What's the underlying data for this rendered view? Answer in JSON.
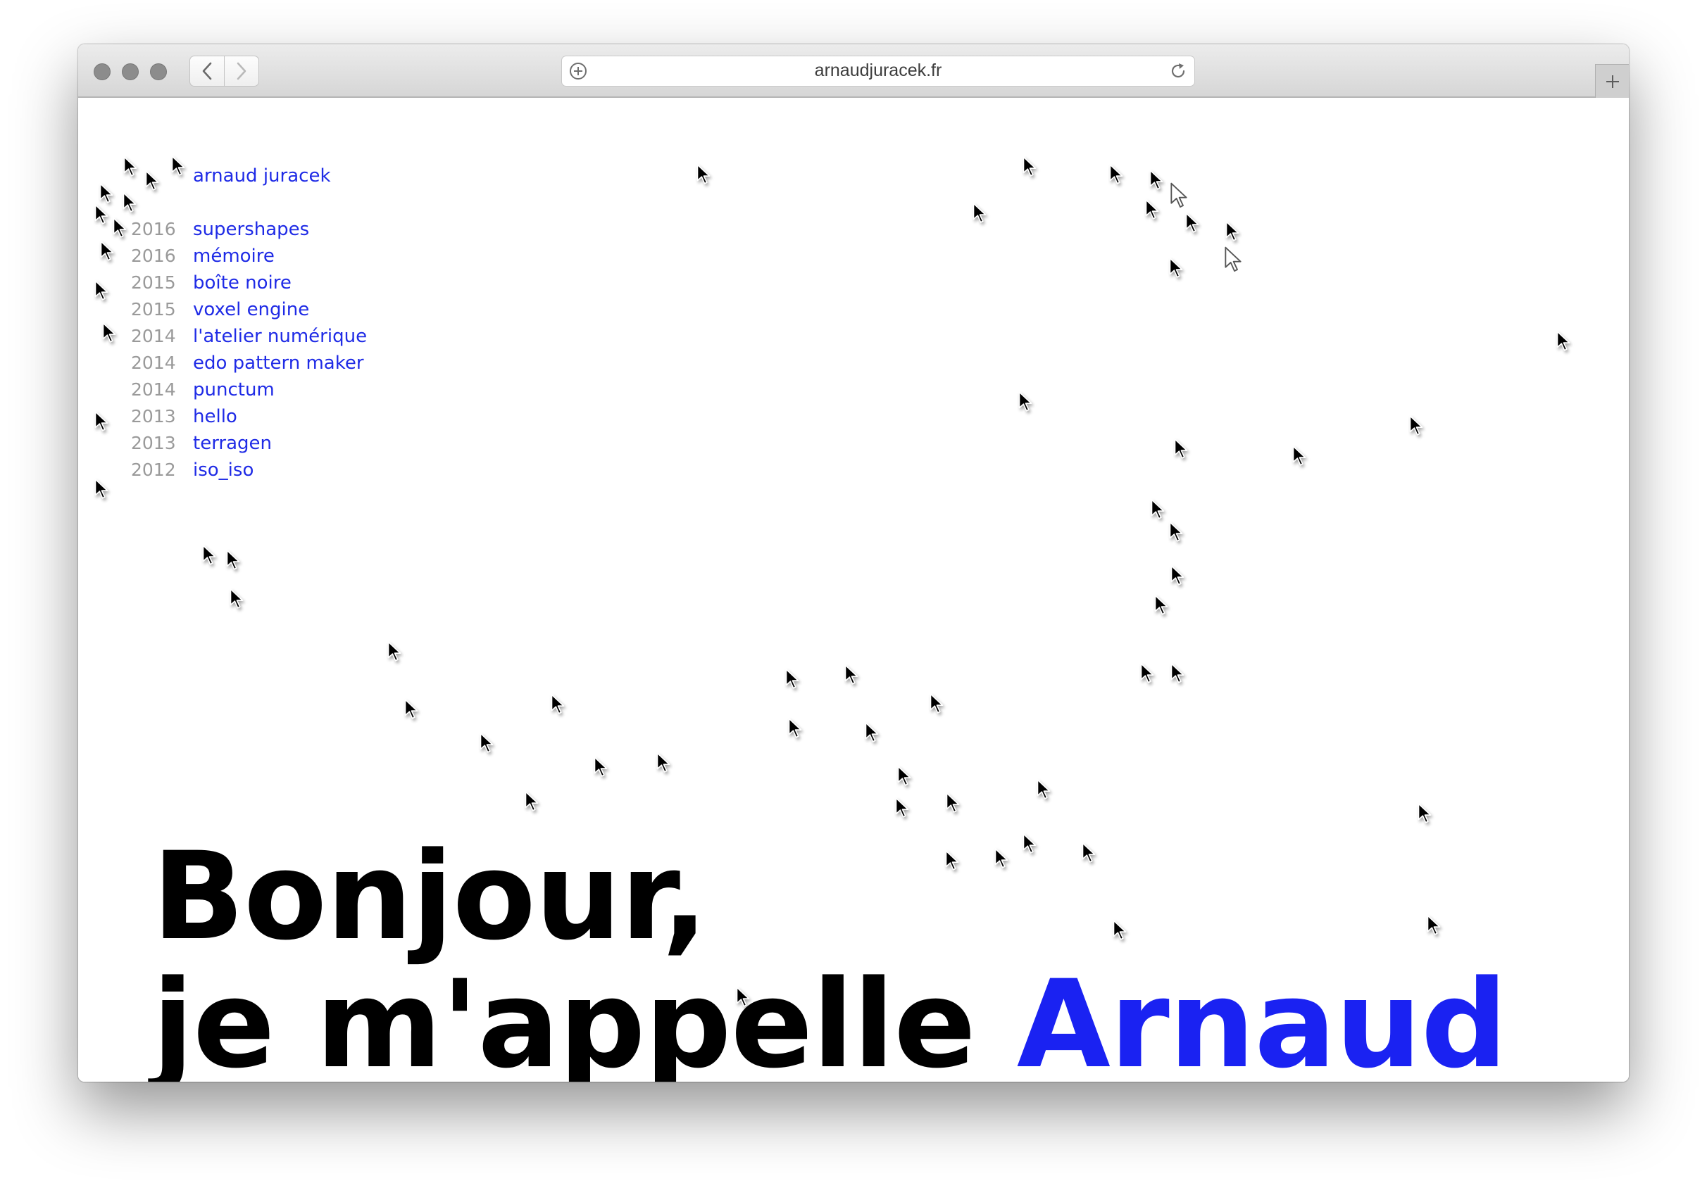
{
  "browser": {
    "url": "arnaudjuracek.fr"
  },
  "page": {
    "site_name": "arnaud juracek",
    "projects": [
      {
        "year": "2016",
        "title": "supershapes"
      },
      {
        "year": "2016",
        "title": "mémoire"
      },
      {
        "year": "2015",
        "title": "boîte noire"
      },
      {
        "year": "2015",
        "title": "voxel engine"
      },
      {
        "year": "2014",
        "title": "l'atelier numérique"
      },
      {
        "year": "2014",
        "title": "edo pattern maker"
      },
      {
        "year": "2014",
        "title": "punctum"
      },
      {
        "year": "2013",
        "title": "hello"
      },
      {
        "year": "2013",
        "title": "terragen"
      },
      {
        "year": "2012",
        "title": "iso_iso"
      }
    ],
    "hero": {
      "line1": "Bonjour,",
      "line2_prefix": "je m'appelle",
      "line2_name": "Arnaud"
    }
  },
  "colors": {
    "link": "#1f2be6",
    "year": "#9a9a9a",
    "hero_text": "#000000",
    "hero_name": "#1a22f2"
  }
}
